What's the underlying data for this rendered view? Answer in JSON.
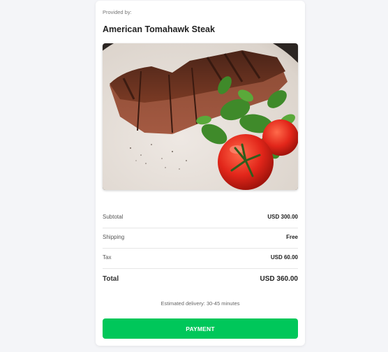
{
  "product": {
    "provided_by_label": "Provided by:",
    "title": "American Tomahawk Steak",
    "image_icon": "steak-photo"
  },
  "summary": {
    "subtotal_label": "Subtotal",
    "subtotal_value": "USD 300.00",
    "shipping_label": "Shipping",
    "shipping_value": "Free",
    "tax_label": "Tax",
    "tax_value": "USD 60.00",
    "total_label": "Total",
    "total_value": "USD 360.00"
  },
  "delivery_text": "Estimated delivery: 30-45 minutes",
  "payment_button_label": "PAYMENT",
  "colors": {
    "accent": "#00c75a",
    "background": "#f4f5f8"
  }
}
